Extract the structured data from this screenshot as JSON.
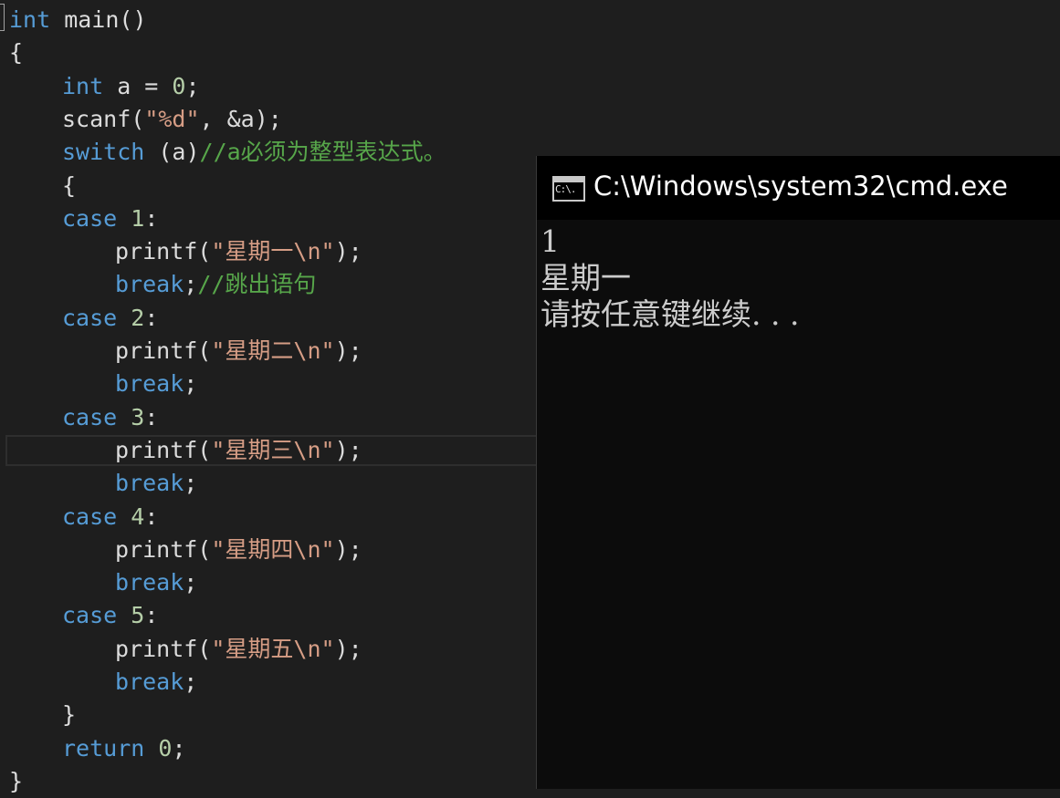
{
  "editor": {
    "lines": [
      {
        "tokens": [
          {
            "t": "int",
            "c": "kw"
          },
          {
            "t": " main()",
            "c": "txt"
          }
        ]
      },
      {
        "tokens": [
          {
            "t": "{",
            "c": "txt"
          }
        ]
      },
      {
        "tokens": [
          {
            "t": "int",
            "c": "kw"
          },
          {
            "t": " a = ",
            "c": "txt"
          },
          {
            "t": "0",
            "c": "num"
          },
          {
            "t": ";",
            "c": "txt"
          }
        ]
      },
      {
        "tokens": [
          {
            "t": "scanf(",
            "c": "txt"
          },
          {
            "t": "\"%d\"",
            "c": "str"
          },
          {
            "t": ", &a);",
            "c": "txt"
          }
        ]
      },
      {
        "tokens": [
          {
            "t": "switch",
            "c": "kw"
          },
          {
            "t": " (a)",
            "c": "txt"
          },
          {
            "t": "//a必须为整型表达式。",
            "c": "cmt"
          }
        ]
      },
      {
        "tokens": [
          {
            "t": "{",
            "c": "txt"
          }
        ]
      },
      {
        "tokens": [
          {
            "t": "case",
            "c": "kw"
          },
          {
            "t": " ",
            "c": "txt"
          },
          {
            "t": "1",
            "c": "num"
          },
          {
            "t": ":",
            "c": "txt"
          }
        ]
      },
      {
        "tokens": [
          {
            "t": "printf(",
            "c": "txt"
          },
          {
            "t": "\"星期一\\n\"",
            "c": "str"
          },
          {
            "t": ");",
            "c": "txt"
          }
        ]
      },
      {
        "tokens": [
          {
            "t": "break",
            "c": "kw"
          },
          {
            "t": ";",
            "c": "txt"
          },
          {
            "t": "//跳出语句",
            "c": "cmt"
          }
        ]
      },
      {
        "tokens": [
          {
            "t": "case",
            "c": "kw"
          },
          {
            "t": " ",
            "c": "txt"
          },
          {
            "t": "2",
            "c": "num"
          },
          {
            "t": ":",
            "c": "txt"
          }
        ]
      },
      {
        "tokens": [
          {
            "t": "printf(",
            "c": "txt"
          },
          {
            "t": "\"星期二\\n\"",
            "c": "str"
          },
          {
            "t": ");",
            "c": "txt"
          }
        ]
      },
      {
        "tokens": [
          {
            "t": "break",
            "c": "kw"
          },
          {
            "t": ";",
            "c": "txt"
          }
        ]
      },
      {
        "tokens": [
          {
            "t": "case",
            "c": "kw"
          },
          {
            "t": " ",
            "c": "txt"
          },
          {
            "t": "3",
            "c": "num"
          },
          {
            "t": ":",
            "c": "txt"
          }
        ]
      },
      {
        "tokens": [
          {
            "t": "printf(",
            "c": "txt"
          },
          {
            "t": "\"星期三\\n\"",
            "c": "str"
          },
          {
            "t": ");",
            "c": "txt"
          }
        ]
      },
      {
        "tokens": [
          {
            "t": "break",
            "c": "kw"
          },
          {
            "t": ";",
            "c": "txt"
          }
        ]
      },
      {
        "tokens": [
          {
            "t": "case",
            "c": "kw"
          },
          {
            "t": " ",
            "c": "txt"
          },
          {
            "t": "4",
            "c": "num"
          },
          {
            "t": ":",
            "c": "txt"
          }
        ]
      },
      {
        "tokens": [
          {
            "t": "printf(",
            "c": "txt"
          },
          {
            "t": "\"星期四\\n\"",
            "c": "str"
          },
          {
            "t": ");",
            "c": "txt"
          }
        ]
      },
      {
        "tokens": [
          {
            "t": "break",
            "c": "kw"
          },
          {
            "t": ";",
            "c": "txt"
          }
        ]
      },
      {
        "tokens": [
          {
            "t": "case",
            "c": "kw"
          },
          {
            "t": " ",
            "c": "txt"
          },
          {
            "t": "5",
            "c": "num"
          },
          {
            "t": ":",
            "c": "txt"
          }
        ]
      },
      {
        "tokens": [
          {
            "t": "printf(",
            "c": "txt"
          },
          {
            "t": "\"星期五\\n\"",
            "c": "str"
          },
          {
            "t": ");",
            "c": "txt"
          }
        ]
      },
      {
        "tokens": [
          {
            "t": "break",
            "c": "kw"
          },
          {
            "t": ";",
            "c": "txt"
          }
        ]
      },
      {
        "tokens": [
          {
            "t": "}",
            "c": "txt"
          }
        ]
      },
      {
        "tokens": [
          {
            "t": "return",
            "c": "kw"
          },
          {
            "t": " ",
            "c": "txt"
          },
          {
            "t": "0",
            "c": "num"
          },
          {
            "t": ";",
            "c": "txt"
          }
        ]
      },
      {
        "tokens": [
          {
            "t": "}",
            "c": "txt"
          }
        ]
      }
    ]
  },
  "console": {
    "title": "C:\\Windows\\system32\\cmd.exe",
    "icon": "console-window-icon",
    "icon_text": "C:\\.",
    "output_lines": [
      "1",
      "星期一",
      "请按任意键继续. . ."
    ]
  },
  "colors": {
    "editor_bg": "#1e1e1e",
    "keyword": "#569cd6",
    "string": "#d69d85",
    "comment": "#57a64a",
    "number": "#b5cea8",
    "console_bg": "#0c0c0c"
  }
}
